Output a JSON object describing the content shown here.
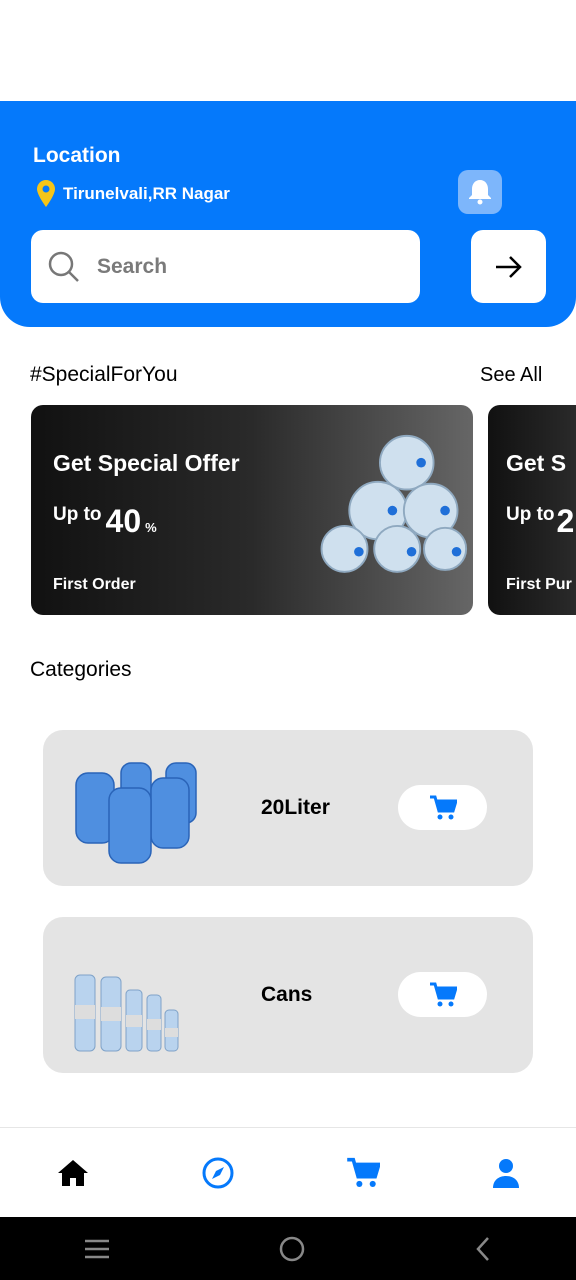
{
  "header": {
    "location_label": "Location",
    "location_value": "Tirunelvali,RR Nagar",
    "search_placeholder": "Search"
  },
  "special": {
    "title": "#SpecialForYou",
    "see_all": "See All",
    "offers": [
      {
        "title": "Get Special Offer",
        "prefix": "Up to",
        "value": "40",
        "unit": "%",
        "note": "First Order"
      },
      {
        "title": "Get S",
        "prefix": "Up to",
        "value": "2",
        "unit": "",
        "note": "First Pur"
      }
    ]
  },
  "categories": {
    "title": "Categories",
    "items": [
      {
        "name": "20Liter"
      },
      {
        "name": "Cans"
      }
    ]
  },
  "colors": {
    "primary": "#0579FB",
    "pin": "#F5C518"
  }
}
